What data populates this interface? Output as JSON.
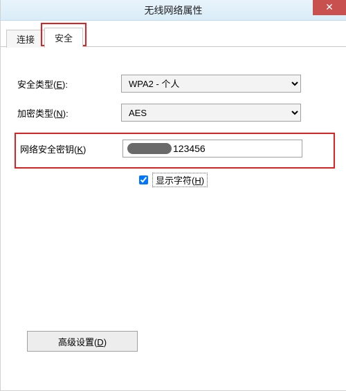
{
  "window": {
    "title": "无线网络属性"
  },
  "tabs": {
    "connect": "连接",
    "security": "安全"
  },
  "form": {
    "securityTypeLabelPre": "安全类型(",
    "securityTypeLabelKey": "E",
    "securityTypeLabelPost": "):",
    "securityTypeValue": "WPA2 - 个人",
    "encryptionTypeLabelPre": "加密类型(",
    "encryptionTypeLabelKey": "N",
    "encryptionTypeLabelPost": "):",
    "encryptionTypeValue": "AES",
    "networkKeyLabelPre": "网络安全密钥(",
    "networkKeyLabelKey": "K",
    "networkKeyLabelPost": ")",
    "networkKeyVisiblePart": "123456",
    "showCharsLabelPre": "显示字符(",
    "showCharsLabelKey": "H",
    "showCharsLabelPost": ")",
    "showCharsChecked": true
  },
  "advancedButton": {
    "labelPre": "高级设置(",
    "labelKey": "D",
    "labelPost": ")"
  }
}
